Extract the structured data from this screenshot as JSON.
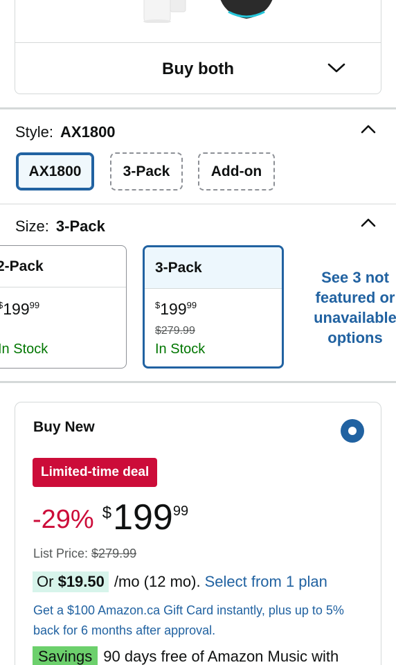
{
  "bundle": {
    "buy_both_label": "Buy both"
  },
  "style_section": {
    "label": "Style:",
    "selected_value": "AX1800",
    "options": [
      "AX1800",
      "3-Pack",
      "Add-on"
    ]
  },
  "size_section": {
    "label": "Size:",
    "selected_value": "3-Pack",
    "tiles": [
      {
        "name": "2-Pack",
        "price_currency": "$",
        "price_whole": "199",
        "price_fraction": "99",
        "stock": "In Stock"
      },
      {
        "name": "3-Pack",
        "price_currency": "$",
        "price_whole": "199",
        "price_fraction": "99",
        "strike_price": "$279.99",
        "stock": "In Stock"
      }
    ],
    "see_more": "See 3 not featured or unavailable options"
  },
  "buy_new": {
    "title": "Buy New",
    "deal_badge": "Limited-time deal",
    "discount": "-29%",
    "price_currency": "$",
    "price_whole": "199",
    "price_fraction": "99",
    "list_price_label": "List Price:",
    "list_price_value": "$279.99",
    "monthly_prefix": "Or",
    "monthly_amount": "$19.50",
    "monthly_term": "/mo (12 mo).",
    "monthly_link": "Select from 1 plan",
    "gift_card_text": "Get a $100 Amazon.ca Gift Card instantly, plus up to 5% back for 6 months after approval.",
    "savings_badge": "Savings",
    "savings_text": "90 days free of Amazon Music with"
  },
  "colors": {
    "link_blue": "#2162a1",
    "deal_red": "#cc0c39",
    "stock_green": "#007600",
    "savings_green": "#6cd06c"
  }
}
